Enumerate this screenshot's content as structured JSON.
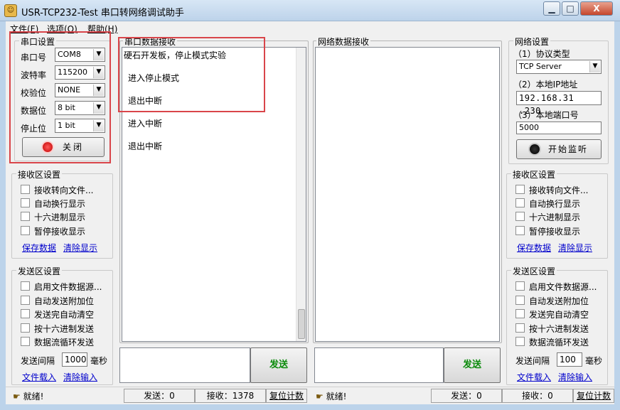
{
  "window": {
    "title": "USR-TCP232-Test 串口转网络调试助手",
    "icon": "app-icon",
    "controls": {
      "minimize": "▁",
      "maximize": "□",
      "close": "X"
    }
  },
  "menu": [
    "文件(F)",
    "选项(O)",
    "帮助(H)"
  ],
  "serial_settings": {
    "title": "串口设置",
    "rows": [
      {
        "label": "串口号",
        "value": "COM8"
      },
      {
        "label": "波特率",
        "value": "115200"
      },
      {
        "label": "校验位",
        "value": "NONE"
      },
      {
        "label": "数据位",
        "value": "8 bit"
      },
      {
        "label": "停止位",
        "value": "1 bit"
      }
    ],
    "close_button": "关闭"
  },
  "serial_recv_settings": {
    "title": "接收区设置",
    "options": [
      "接收转向文件...",
      "自动换行显示",
      "十六进制显示",
      "暂停接收显示"
    ],
    "save_link": "保存数据",
    "clear_link": "清除显示"
  },
  "serial_send_settings": {
    "title": "发送区设置",
    "options": [
      "启用文件数据源...",
      "自动发送附加位",
      "发送完自动清空",
      "按十六进制发送",
      "数据流循环发送"
    ],
    "interval_label": "发送间隔",
    "interval_value": "1000",
    "interval_unit": "毫秒",
    "file_link": "文件载入",
    "clear_link": "清除输入"
  },
  "serial_recv": {
    "title": "串口数据接收",
    "lines": [
      "硬石开发板，停止模式实验",
      "进入停止模式",
      "退出中断",
      "进入中断",
      "退出中断"
    ]
  },
  "net_recv": {
    "title": "网络数据接收"
  },
  "send_label": "发送",
  "net_settings": {
    "title": "网络设置",
    "protocol_label": "（1）协议类型",
    "protocol_value": "TCP Server",
    "ip_label": "（2）本地IP地址",
    "ip_value": "192.168.31 .230",
    "port_label": "（3）本地端口号",
    "port_value": "5000",
    "listen_button": "开始监听"
  },
  "net_recv_settings": {
    "title": "接收区设置",
    "options": [
      "接收转向文件...",
      "自动换行显示",
      "十六进制显示",
      "暂停接收显示"
    ],
    "save_link": "保存数据",
    "clear_link": "清除显示"
  },
  "net_send_settings": {
    "title": "发送区设置",
    "options": [
      "启用文件数据源...",
      "自动发送附加位",
      "发送完自动清空",
      "按十六进制发送",
      "数据流循环发送"
    ],
    "interval_label": "发送间隔",
    "interval_value": "100",
    "interval_unit": "毫秒",
    "file_link": "文件载入",
    "clear_link": "清除输入"
  },
  "status_left": {
    "ready": "就绪!",
    "sent": "发送：0",
    "received": "接收：1378",
    "reset": "复位计数"
  },
  "status_right": {
    "ready": "就绪!",
    "sent": "发送：0",
    "received": "接收：0",
    "reset": "复位计数"
  },
  "colors": {
    "annotation": "#d9454a",
    "send_text": "#0a8a0a",
    "link": "#0000cc",
    "indicator_red": "#e01010"
  }
}
